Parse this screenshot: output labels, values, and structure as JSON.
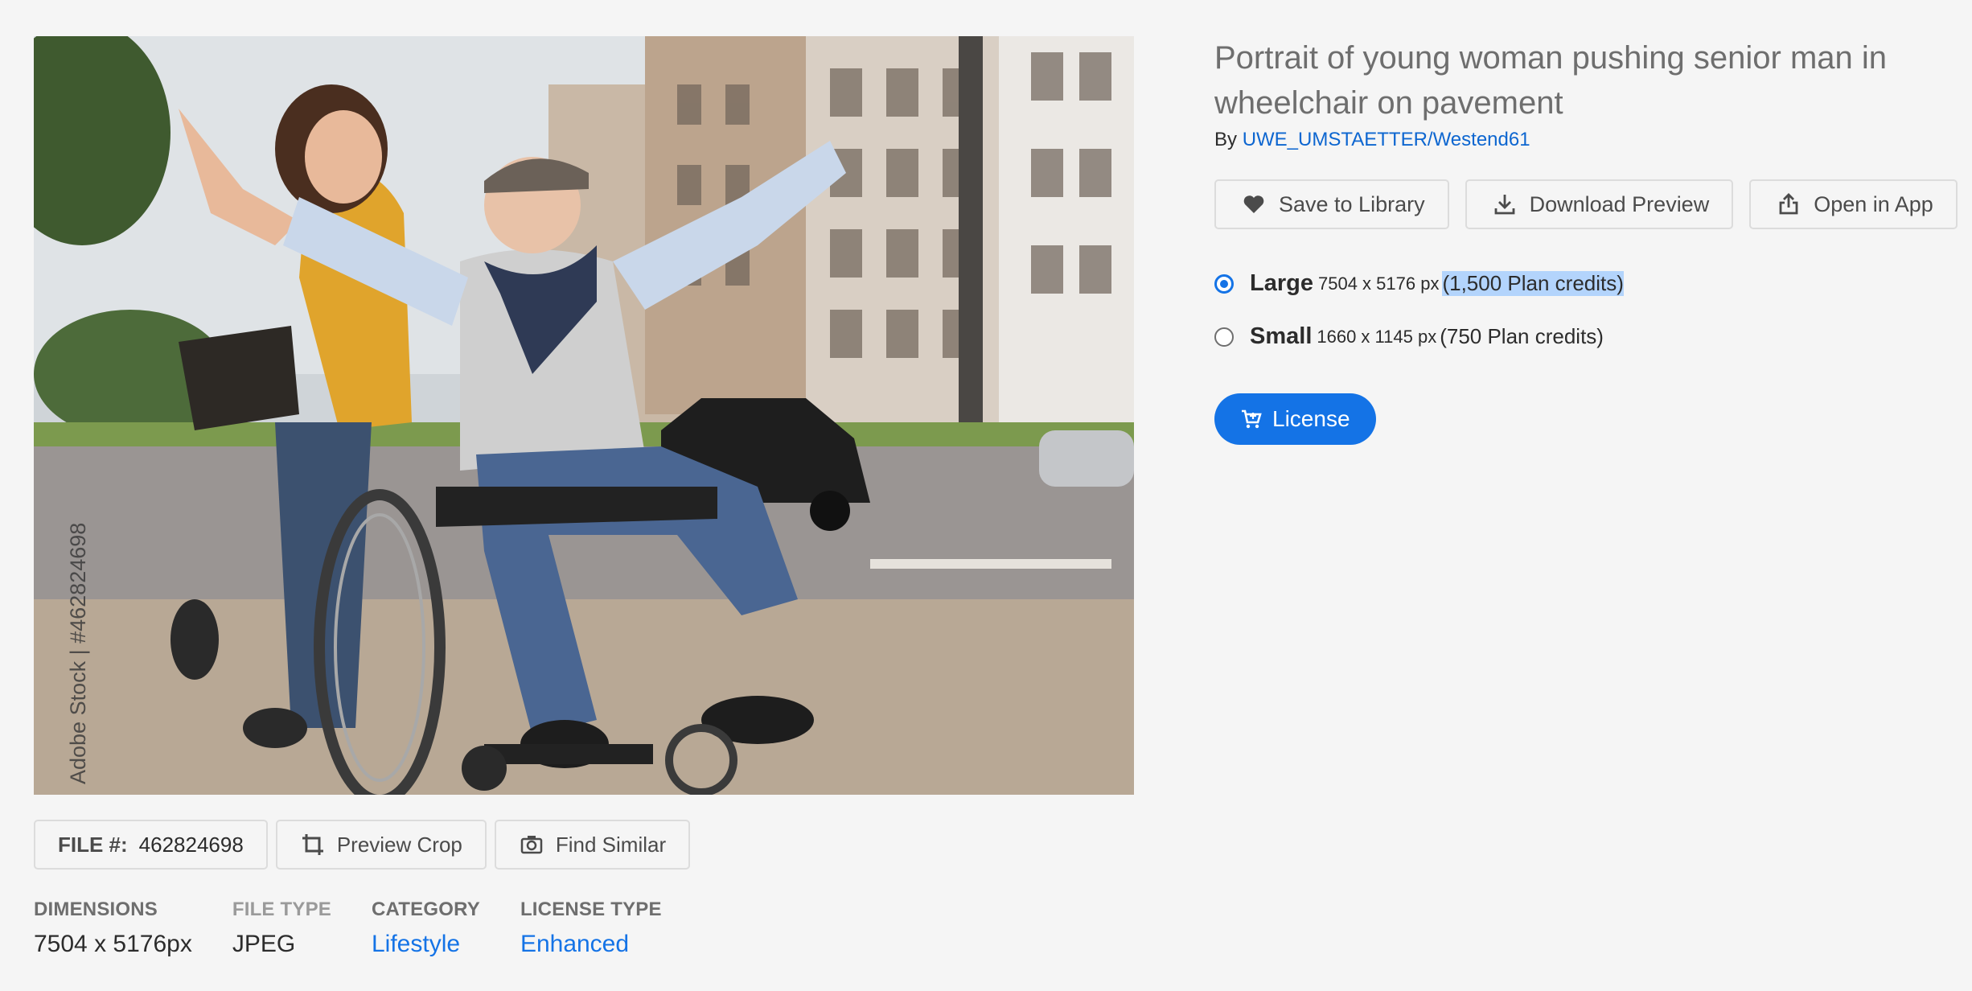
{
  "photo": {
    "alt": "Portrait of young woman pushing senior man in wheelchair on pavement",
    "watermark": "Adobe Stock | #462824698"
  },
  "asset": {
    "title": "Portrait of young woman pushing senior man in wheelchair on pavement",
    "by_prefix": "By",
    "author": "UWE_UMSTAETTER/Westend61"
  },
  "actions": {
    "save_label": "Save to Library",
    "download_label": "Download Preview",
    "open_label": "Open in App"
  },
  "sizes": [
    {
      "name": "Large",
      "dims": "7504 x 5176 px",
      "credits": "(1,500 Plan credits)",
      "selected": true
    },
    {
      "name": "Small",
      "dims": "1660 x 1145 px",
      "credits": "(750 Plan credits)",
      "selected": false
    }
  ],
  "license_label": "License",
  "file": {
    "label": "FILE #:",
    "number": "462824698",
    "preview_crop_label": "Preview Crop",
    "find_similar_label": "Find Similar"
  },
  "meta": {
    "dimensions": {
      "label": "DIMENSIONS",
      "value": "7504 x 5176px"
    },
    "file_type": {
      "label": "FILE TYPE",
      "value": "JPEG"
    },
    "category": {
      "label": "CATEGORY",
      "value": "Lifestyle"
    },
    "license_type": {
      "label": "LICENSE TYPE",
      "value": "Enhanced"
    }
  },
  "colors": {
    "accent": "#1473e6",
    "link": "#0d66d0",
    "highlight": "#b3d4fc",
    "background": "#f5f5f5"
  },
  "icons": [
    "heart-icon",
    "download-icon",
    "share-icon",
    "crop-icon",
    "camera-icon",
    "cart-icon"
  ]
}
